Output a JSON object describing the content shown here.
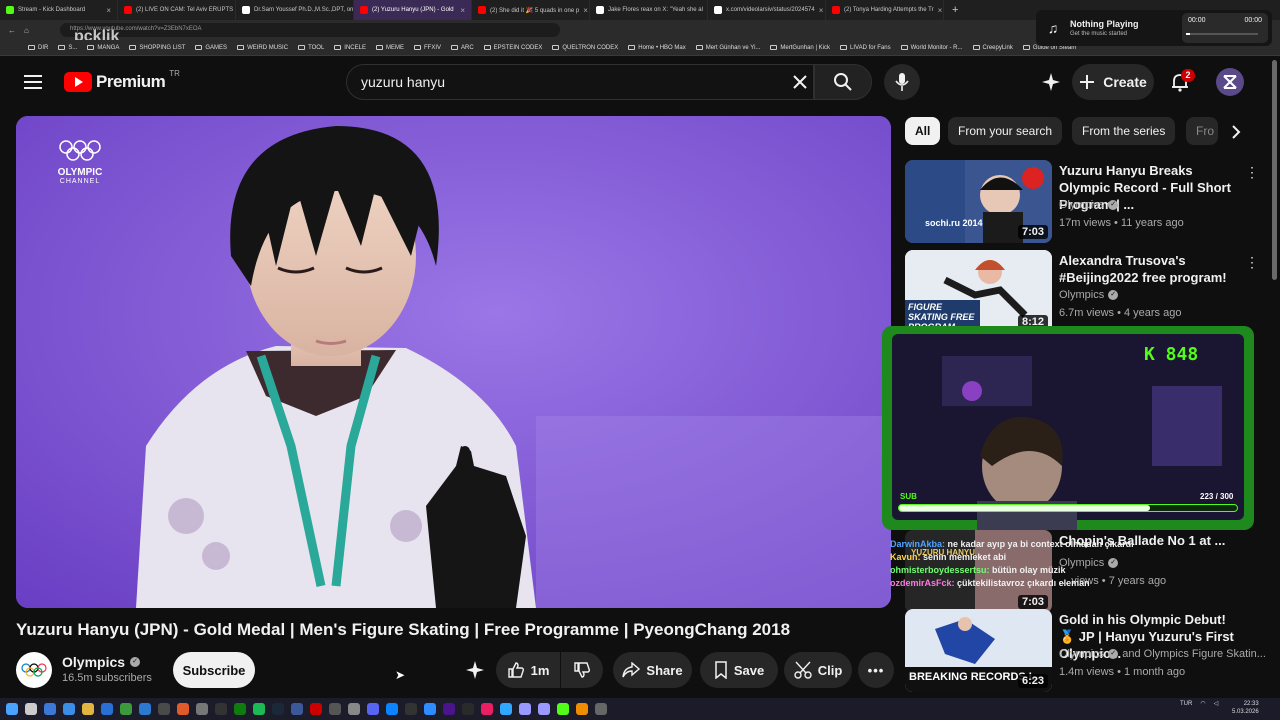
{
  "browser": {
    "tabs": [
      {
        "label": "Stream - Kick Dashboard",
        "color": "#53fc18",
        "active": false
      },
      {
        "label": "(2) LIVE ON CAM: Tel Aviv ERUPTS",
        "color": "#ff0000",
        "active": false
      },
      {
        "label": "Dr.Sam Youssef Ph.D.,M.Sc.,DPT, on X",
        "color": "#ffffff",
        "active": false
      },
      {
        "label": "(2) Yuzuru Hanyu (JPN) - Gold",
        "color": "#ff0000",
        "active": true
      },
      {
        "label": "(2) She did it 🎉 5 quads in one p",
        "color": "#ff0000",
        "active": false
      },
      {
        "label": "Jake Flores reax on X: \"Yeah she al",
        "color": "#ffffff",
        "active": false
      },
      {
        "label": "x.com/videolarsiv/status/2024574",
        "color": "#ffffff",
        "active": false
      },
      {
        "label": "(2) Tonya Harding Attempts the Tr",
        "color": "#ff0000",
        "active": false
      }
    ],
    "url": "https://www.youtube.com/watch?v=Z3EbN7xEOA",
    "bookmarks": [
      "DIR",
      "S...",
      "MANGA",
      "SHOPPING LIST",
      "GAMES",
      "WEIRD MUSIC",
      "TOOL",
      "INCELE",
      "MEME",
      "FFXIV",
      "ARC",
      "EPSTEIN CODEX",
      "QUELTRON CODEX",
      "Home • HBO Max",
      "Mert Günhan ve Yi...",
      "MertGunhan | Kick",
      "LIVAD for Fans",
      "World Monitor - R...",
      "CreepyLink",
      "Guide on Steam"
    ],
    "watermark": "pcklik"
  },
  "media": {
    "title": "Nothing Playing",
    "subtitle": "Get the music started",
    "time_start": "00:00",
    "time_end": "00:00",
    "progress": 0.05
  },
  "header": {
    "logo": "Premium",
    "region": "TR",
    "search_value": "yuzuru hanyu",
    "create_label": "Create",
    "notif_count": "2"
  },
  "chips": [
    "All",
    "From your search",
    "From the series",
    "Fro"
  ],
  "video": {
    "watermark_line1": "OLYMPIC",
    "watermark_line2": "CHANNEL",
    "title": "Yuzuru Hanyu (JPN) - Gold Medal | Men's Figure Skating | Free Programme | PyeongChang 2018",
    "channel": "Olympics",
    "subscribers": "16.5m subscribers",
    "subscribe_label": "Subscribe",
    "likes": "1m",
    "share_label": "Share",
    "save_label": "Save",
    "clip_label": "Clip"
  },
  "recommendations": [
    {
      "title": "Yuzuru Hanyu Breaks Olympic Record - Full Short Program | ...",
      "channel": "Olympics",
      "meta": "17m views • 11 years ago",
      "duration": "7:03",
      "thumb_text": "sochi.ru 2014"
    },
    {
      "title": "Alexandra Trusova's #Beijing2022 free program!",
      "channel": "Olympics",
      "meta": "6.7m views • 4 years ago",
      "duration": "8:12",
      "thumb_text": "FIGURE SKATING FREE PROGRAM"
    },
    {
      "title": "Chopin's Ballade No 1 at ...",
      "channel": "Olympics",
      "meta": "... views • 7 years ago",
      "duration": "7:03",
      "thumb_text": "YUZURU HANYU"
    },
    {
      "title": "Gold in his Olympic Debut! 🏅 JP | Hanyu Yuzuru's First Olympic...",
      "channel": "Olympics",
      "channel_extra": "and Olympics Figure Skatin...",
      "meta": "1.4m views • 1 month ago",
      "duration": "6:23",
      "thumb_text": "BREAKING RECORDS L..."
    }
  ],
  "stream": {
    "k_count": "K 848",
    "sub_label": "SUB",
    "sub_count": "223 / 300",
    "sub_progress": 0.743,
    "chat": [
      {
        "user": "DarwinAkba:",
        "text": "ne kadar ayıp ya bi context olmadan çıkardı",
        "color": "#4fa3ff"
      },
      {
        "user": "Kavun:",
        "text": "senin memleket abi",
        "color": "#ffd84f"
      },
      {
        "user": "ohmisterboydessertsu:",
        "text": "bütün olay müzik",
        "color": "#6fff6f"
      },
      {
        "user": "ozdemirAsFck:",
        "text": "çüktekilistavroz çıkardı eleman",
        "color": "#ff7ae0"
      }
    ]
  },
  "taskbar": {
    "lang": "TUR",
    "time": "22:33",
    "date": "5.03.2026"
  }
}
